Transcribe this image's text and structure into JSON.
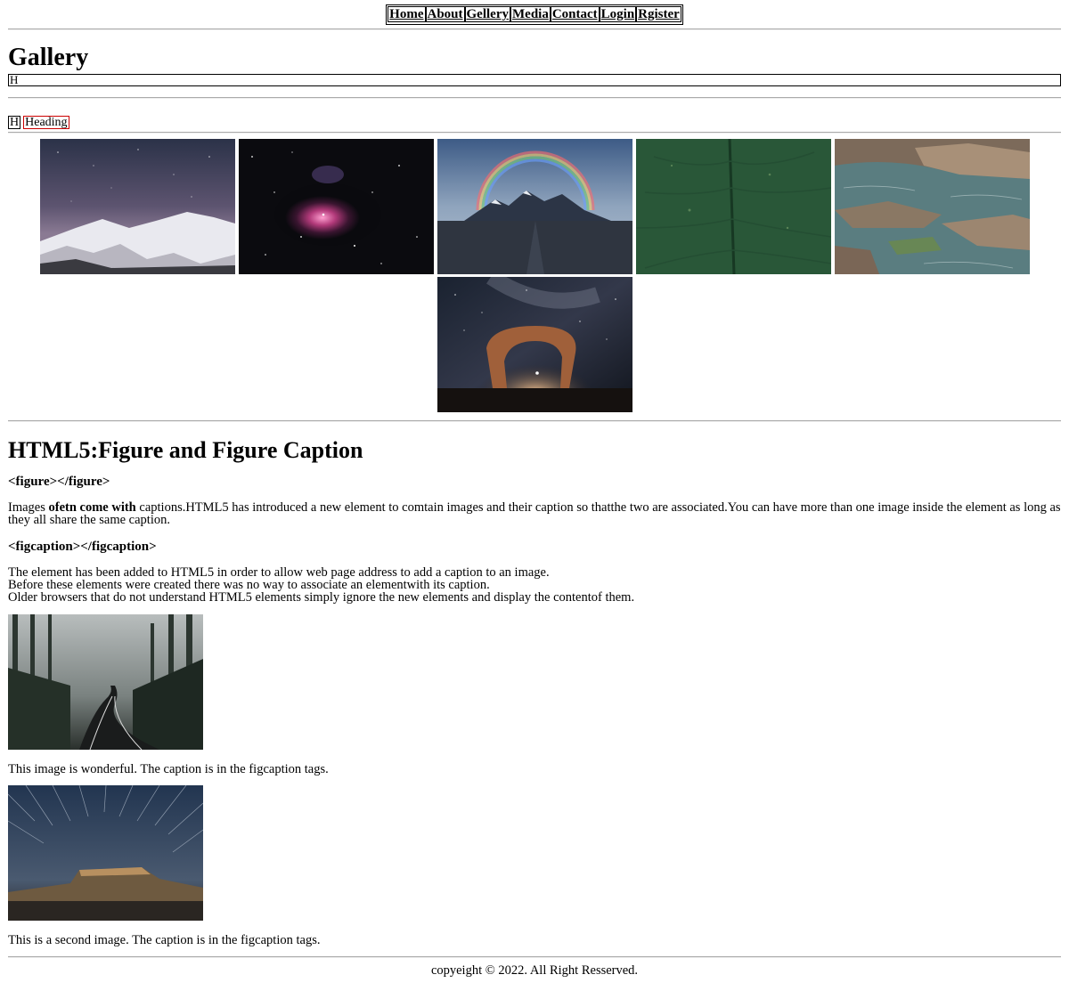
{
  "nav": {
    "items": [
      "Home",
      "About",
      "Gellery",
      "Media",
      "Contact",
      "Login",
      "Rgister"
    ]
  },
  "gallery": {
    "title": "Gallery",
    "h_box_text": "H",
    "h_small_text": "H",
    "heading_text": "Heading",
    "images": [
      {
        "icon": "snowy-mountains-night-image"
      },
      {
        "icon": "orion-nebula-image"
      },
      {
        "icon": "rainbow-mountain-image"
      },
      {
        "icon": "green-leaf-image"
      },
      {
        "icon": "rocky-shore-water-image"
      },
      {
        "icon": "stone-arch-milky-way-image"
      }
    ]
  },
  "article": {
    "title": "HTML5:Figure and Figure Caption",
    "figure_heading": "<figure></figure>",
    "para1_a": "Images ",
    "para1_bold": "ofetn come with",
    "para1_b": " captions.HTML5 has introduced a new element to comtain images and their caption so thatthe two are associated.You can have more than one image inside the element as long as they all share the same caption.",
    "figcaption_heading": "<figcaption></figcaption>",
    "para2_line1": "The element has been added to HTML5 in order to allow web page address to add a caption to an image.",
    "para2_line2": "Before these elements were created there was no way to associate an elementwith its caption.",
    "para2_line3": "Older browsers that do not understand HTML5 elements simply ignore the new elements and display the contentof them.",
    "figures": [
      {
        "icon": "misty-forest-road-image",
        "caption": "This image is wonderful. The caption is in the figcaption tags."
      },
      {
        "icon": "star-trails-mesa-image",
        "caption": "This is a second image. The caption is in the figcaption tags."
      }
    ]
  },
  "footer": {
    "text": "copyeight © 2022. All Right Resserved."
  }
}
